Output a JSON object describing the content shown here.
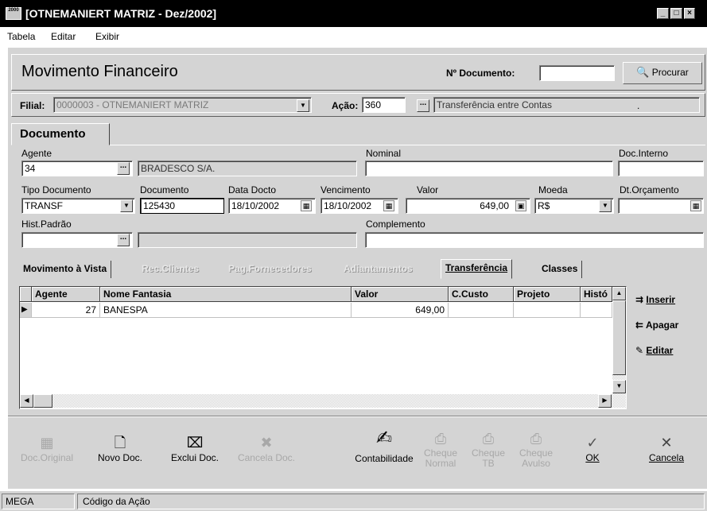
{
  "window": {
    "title": "[OTNEMANIERT MATRIZ - Dez/2002]",
    "icon_text": "2000"
  },
  "menu": {
    "items": [
      "Tabela",
      "Editar",
      "Exibir"
    ]
  },
  "header": {
    "title": "Movimento Financeiro",
    "doc_number_label": "Nº Documento:",
    "doc_number_value": "",
    "search_button": "Procurar"
  },
  "filters": {
    "filial_label": "Filial:",
    "filial_value": "0000003 - OTNEMANIERT MATRIZ",
    "acao_label": "Ação:",
    "acao_code": "360",
    "acao_description": "Transferência entre Contas",
    "acao_extra": "."
  },
  "document_tab": {
    "label": "Documento"
  },
  "form": {
    "agente_label": "Agente",
    "agente_code": "34",
    "agente_name": "BRADESCO S/A.",
    "nominal_label": "Nominal",
    "nominal_value": "",
    "doc_interno_label": "Doc.Interno",
    "doc_interno_value": "",
    "tipo_doc_label": "Tipo Documento",
    "tipo_doc_value": "TRANSF",
    "documento_label": "Documento",
    "documento_value": "125430",
    "data_docto_label": "Data Docto",
    "data_docto_value": "18/10/2002",
    "vencimento_label": "Vencimento",
    "vencimento_value": "18/10/2002",
    "valor_label": "Valor",
    "valor_value": "649,00",
    "moeda_label": "Moeda",
    "moeda_value": "R$",
    "dt_orcamento_label": "Dt.Orçamento",
    "dt_orcamento_value": "",
    "hist_padrao_label": "Hist.Padrão",
    "hist_padrao_code": "",
    "hist_padrao_desc": "",
    "complemento_label": "Complemento",
    "complemento_value": ""
  },
  "tabs": [
    {
      "label": "Movimento à Vista",
      "enabled": true
    },
    {
      "label": "Rec.Clientes",
      "enabled": false
    },
    {
      "label": "Pag.Fornecedores",
      "enabled": false
    },
    {
      "label": "Adiantamentos",
      "enabled": false
    },
    {
      "label": "Transferência",
      "enabled": true,
      "active": true
    },
    {
      "label": "Classes",
      "enabled": true
    }
  ],
  "grid": {
    "columns": [
      "Agente",
      "Nome Fantasia",
      "Valor",
      "C.Custo",
      "Projeto",
      "Histó"
    ],
    "rows": [
      {
        "agente": "27",
        "nome": "BANESPA",
        "valor": "649,00",
        "ccusto": "",
        "projeto": "",
        "hist": ""
      }
    ]
  },
  "grid_actions": {
    "insert": "Inserir",
    "delete": "Apagar",
    "edit": "Editar"
  },
  "toolbar": {
    "doc_original": "Doc.Original",
    "novo_doc": "Novo Doc.",
    "exclui_doc": "Exclui Doc.",
    "cancela_doc": "Cancela Doc.",
    "contabilidade": "Contabilidade",
    "cheque_normal_1": "Cheque",
    "cheque_normal_2": "Normal",
    "cheque_tb_1": "Cheque",
    "cheque_tb_2": "TB",
    "cheque_avulso_1": "Cheque",
    "cheque_avulso_2": "Avulso",
    "ok": "OK",
    "cancela": "Cancela"
  },
  "statusbar": {
    "left": "MEGA",
    "right": "Código da Ação"
  },
  "colors": {
    "title_bg": "#000000",
    "panel": "#d4d4d4",
    "disabled_text": "#a8a8a8"
  }
}
